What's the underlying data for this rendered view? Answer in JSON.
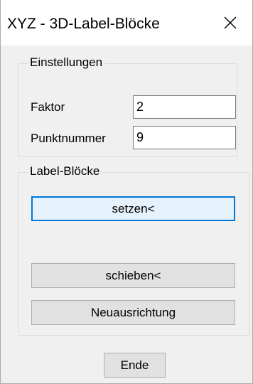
{
  "window": {
    "title": "XYZ - 3D-Label-Blöcke",
    "close_icon": "close-icon"
  },
  "settings": {
    "legend": "Einstellungen",
    "factor_label": "Faktor",
    "factor_value": "2",
    "point_number_label": "Punktnummer",
    "point_number_value": "9"
  },
  "label_blocks": {
    "legend": "Label-Blöcke",
    "set_button": "setzen<",
    "move_button": "schieben<",
    "realign_button": "Neuausrichtung"
  },
  "footer": {
    "end_button": "Ende"
  },
  "colors": {
    "focus_border": "#0078d7",
    "button_face": "#e1e1e1",
    "dialog_background": "#f0f0f0"
  }
}
